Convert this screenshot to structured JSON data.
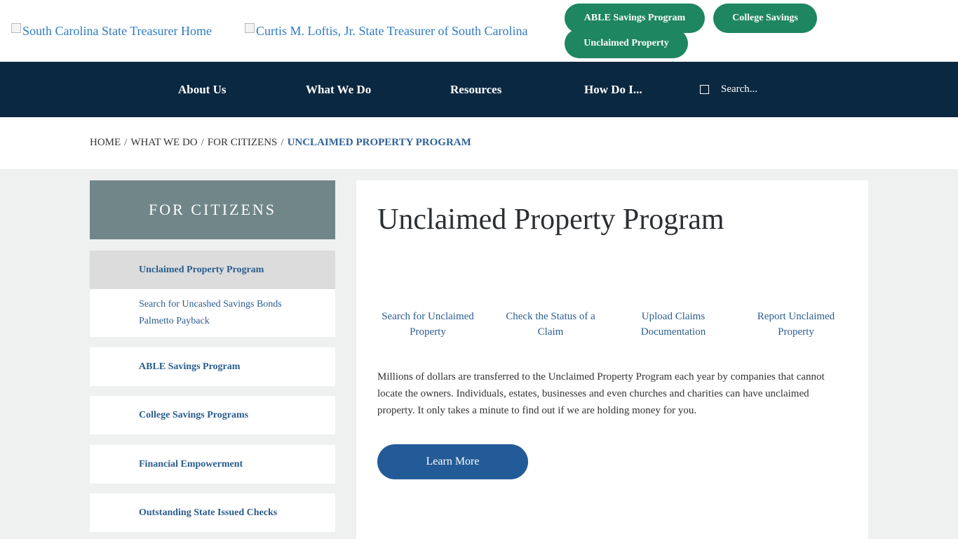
{
  "header": {
    "logo_home_alt": "South Carolina State Treasurer Home",
    "logo_treasurer_alt": "Curtis M. Loftis, Jr. State Treasurer of South Carolina",
    "pills": {
      "able": "ABLE Savings Program",
      "college": "College Savings",
      "unclaimed": "Unclaimed Property"
    },
    "colors": {
      "pill": "#1e8660",
      "navbar": "#0b2841"
    }
  },
  "nav": {
    "items": [
      "About Us",
      "What We Do",
      "Resources",
      "How Do I..."
    ],
    "search_placeholder": "Search..."
  },
  "breadcrumb": {
    "items": [
      "HOME",
      "WHAT WE DO",
      "FOR CITIZENS"
    ],
    "current": "UNCLAIMED PROPERTY PROGRAM",
    "separator": "/"
  },
  "sidebar": {
    "heading": "FOR CITIZENS",
    "active_item": "Unclaimed Property Program",
    "sub_items": [
      "Search for Uncashed Savings Bonds",
      "Palmetto Payback"
    ],
    "items": [
      "ABLE Savings Program",
      "College Savings Programs",
      "Financial Empowerment",
      "Outstanding State Issued Checks"
    ]
  },
  "main": {
    "title": "Unclaimed Property Program",
    "quick_links": [
      "Search for Unclaimed Property",
      "Check the Status of a Claim",
      "Upload Claims Documentation",
      "Report Unclaimed Property"
    ],
    "intro": "Millions of dollars are transferred to the Unclaimed Property Program each year by companies that cannot locate the owners. Individuals, estates, businesses and even churches and charities can have unclaimed property. It only takes a minute to find out if we are holding money for you.",
    "button_label": "Learn More"
  }
}
